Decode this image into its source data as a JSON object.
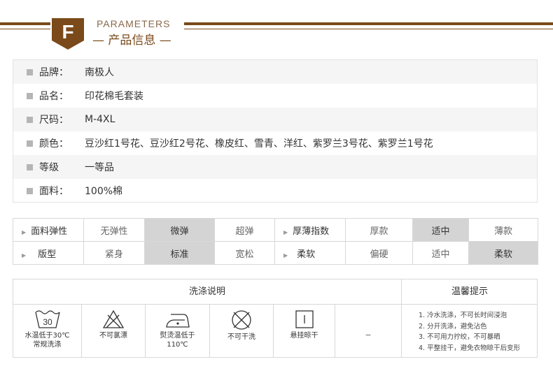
{
  "header": {
    "badge_letter": "F",
    "en_title": "PARAMETERS",
    "cn_title": "— 产品信息 —"
  },
  "info": [
    {
      "label": "品牌：",
      "value": "南极人"
    },
    {
      "label": "品名：",
      "value": "印花棉毛套装"
    },
    {
      "label": "尺码：",
      "value": "M-4XL"
    },
    {
      "label": "颜色：",
      "value": "豆沙红1号花、豆沙红2号花、橡皮红、雪青、洋红、紫罗兰3号花、紫罗兰1号花"
    },
    {
      "label": "等级",
      "value": "一等品"
    },
    {
      "label": "面料：",
      "value": "100%棉"
    }
  ],
  "attributes": {
    "elasticity": {
      "label": "面料弹性",
      "options": [
        "无弹性",
        "微弹",
        "超弹"
      ],
      "selected": "微弹"
    },
    "thickness": {
      "label": "厚薄指数",
      "options": [
        "厚款",
        "适中",
        "薄款"
      ],
      "selected": "适中"
    },
    "fit": {
      "label": "版型",
      "options": [
        "紧身",
        "标准",
        "宽松"
      ],
      "selected": "标准"
    },
    "softness": {
      "label": "柔软",
      "options": [
        "偏硬",
        "适中",
        "柔软"
      ],
      "selected": "柔软"
    }
  },
  "care": {
    "title": "洗涤说明",
    "tip_title": "温馨提示",
    "items": [
      {
        "icon": "wash-30-icon",
        "number": "30",
        "text1": "水温低于30℃",
        "text2": "常规洗涤"
      },
      {
        "icon": "no-bleach-icon",
        "text1": "不可氯漂"
      },
      {
        "icon": "iron-110-icon",
        "text1": "熨烫温低于",
        "text2": "110℃"
      },
      {
        "icon": "no-dry-clean-icon",
        "text1": "不可干洗"
      },
      {
        "icon": "hang-dry-icon",
        "text1": "悬挂晾干"
      },
      {
        "icon": "empty",
        "text1": "_"
      }
    ],
    "tips": [
      "1. 冷水洗涤，不可长时间浸泡",
      "2. 分开洗涤，避免沾色",
      "3. 不可用力拧绞，不可暴晒",
      "4. 平整挂干，避免衣物晾干后变形"
    ]
  }
}
